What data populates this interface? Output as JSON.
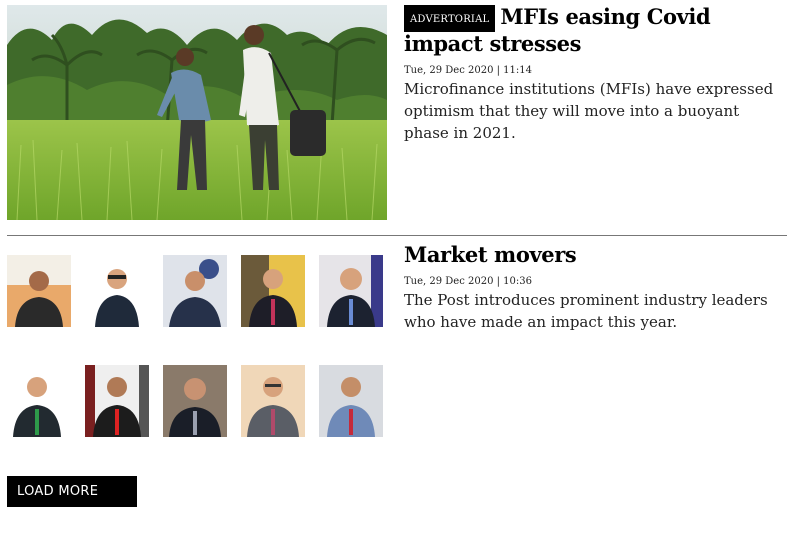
{
  "articles": [
    {
      "badge": "ADVERTORIAL",
      "headline": "MFIs easing Covid impact stresses",
      "meta": "Tue, 29 Dec 2020 | 11:14",
      "summary": "Microfinance institutions (MFIs) have expressed optimism that they will move into a buoyant phase in 2021.",
      "image": "rice-field-photo"
    },
    {
      "headline": "Market movers",
      "meta": "Tue, 29 Dec 2020 | 10:36",
      "summary": "The Post introduces prominent industry leaders who have made an impact this year.",
      "image": "portrait-grid-10"
    }
  ],
  "load_more_label": "LOAD MORE"
}
